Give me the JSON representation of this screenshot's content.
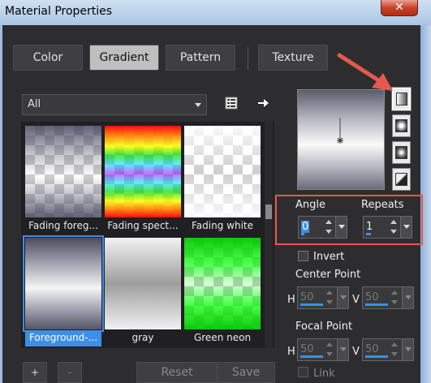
{
  "window": {
    "title": "Material Properties",
    "close_glyph": "✕"
  },
  "tabs": [
    {
      "label": "Color",
      "active": false
    },
    {
      "label": "Gradient",
      "active": true
    },
    {
      "label": "Pattern",
      "active": false
    },
    {
      "label": "Texture",
      "active": false
    }
  ],
  "filter": {
    "selected": "All"
  },
  "gradients": [
    {
      "label": "Fading foreg...",
      "selected": false
    },
    {
      "label": "Fading spect...",
      "selected": false
    },
    {
      "label": "Fading white",
      "selected": false
    },
    {
      "label": "Foreground-...",
      "selected": true
    },
    {
      "label": "gray",
      "selected": false
    },
    {
      "label": "Green neon",
      "selected": false
    }
  ],
  "grid_buttons": {
    "add": "+",
    "remove": "-",
    "reset": "Reset",
    "save": "Save"
  },
  "angle": {
    "label": "Angle",
    "value": "0"
  },
  "repeats": {
    "label": "Repeats",
    "value": "1"
  },
  "invert": {
    "label": "Invert",
    "checked": false
  },
  "center_point": {
    "label": "Center Point",
    "h_label": "H",
    "h_value": "50",
    "v_label": "V",
    "v_value": "50"
  },
  "focal_point": {
    "label": "Focal Point",
    "h_label": "H",
    "h_value": "50",
    "v_label": "V",
    "v_value": "50"
  },
  "link": {
    "label": "Link",
    "checked": false
  },
  "colors": {
    "accent": "#3d8ee6",
    "annotation": "#e5584d"
  }
}
